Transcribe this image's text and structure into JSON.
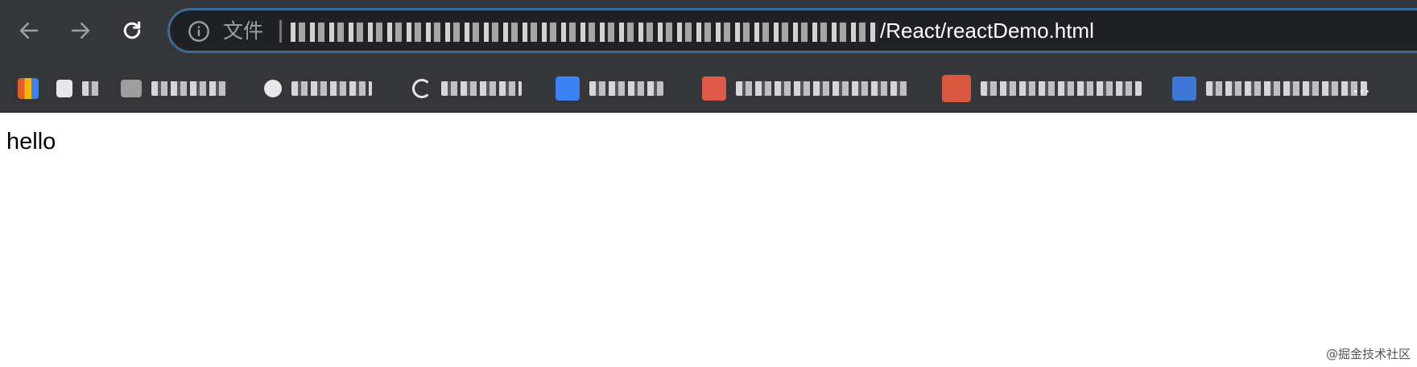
{
  "browser": {
    "back_label": "Back",
    "forward_label": "Forward",
    "reload_label": "Reload",
    "address_bar": {
      "scheme_label": "文件",
      "url_visible_suffix": "/React/reactDemo.html",
      "info_icon": "info-icon"
    },
    "bookmarks": [
      {
        "icon": "apps-grid-icon",
        "icon_color": "#e35d2c"
      },
      {
        "icon": "white-folder-icon",
        "icon_color": "#e8e8e8"
      },
      {
        "icon": "folder-icon",
        "icon_color": "#9e9e9e"
      },
      {
        "icon": "arrow-icon",
        "icon_color": "#e8e8e8"
      },
      {
        "icon": "loader-icon",
        "icon_color": "#e8e8e8"
      },
      {
        "icon": "blue-doc-icon",
        "icon_color": "#3b82f6"
      },
      {
        "icon": "red-square-icon",
        "icon_color": "#e05a4a"
      },
      {
        "icon": "refresh-red-icon",
        "icon_color": "#d9583f"
      },
      {
        "icon": "blue-square-icon",
        "icon_color": "#3d78d8"
      }
    ],
    "bookmarks_more": "…"
  },
  "page": {
    "body_text": "hello",
    "watermark": "@掘金技术社区"
  },
  "colors": {
    "toolbar": "#35363a",
    "omnibox_bg": "#202124",
    "omnibox_border": "#3d6a96",
    "page_bg": "#ffffff"
  }
}
